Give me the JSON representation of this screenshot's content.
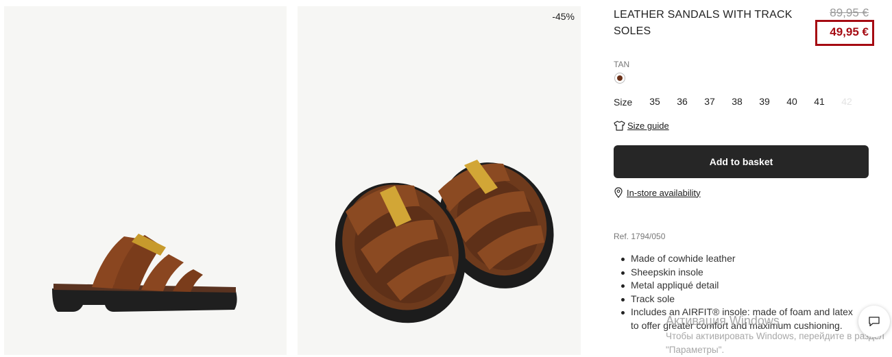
{
  "gallery": {
    "discount_badge": "-45%"
  },
  "product": {
    "title": "LEATHER SANDALS WITH TRACK SOLES",
    "old_price": "89,95 €",
    "new_price": "49,95 €",
    "color": {
      "label": "TAN",
      "swatch_hex": "#6b3119"
    },
    "size_label": "Size",
    "sizes": [
      {
        "label": "35",
        "available": true
      },
      {
        "label": "36",
        "available": true
      },
      {
        "label": "37",
        "available": true
      },
      {
        "label": "38",
        "available": true
      },
      {
        "label": "39",
        "available": true
      },
      {
        "label": "40",
        "available": true
      },
      {
        "label": "41",
        "available": true
      },
      {
        "label": "42",
        "available": false
      }
    ],
    "size_guide": "Size guide",
    "add_to_basket": "Add to basket",
    "in_store": "In-store availability",
    "ref": "Ref. 1794/050",
    "features": [
      "Made of cowhide leather",
      "Sheepskin insole",
      "Metal appliqué detail",
      "Track sole",
      "Includes an AIRFIT® insole: made of foam and latex to offer greater comfort and maximum cushioning."
    ]
  },
  "overlay": {
    "title": "Активация Windows",
    "text": "Чтобы активировать Windows, перейдите в раздел \"Параметры\"."
  },
  "colors": {
    "price_red": "#a50a12",
    "button_dark": "#262626"
  },
  "icons": {
    "size_guide": "tshirt-icon",
    "in_store": "location-pin-icon",
    "chat": "chat-icon"
  }
}
